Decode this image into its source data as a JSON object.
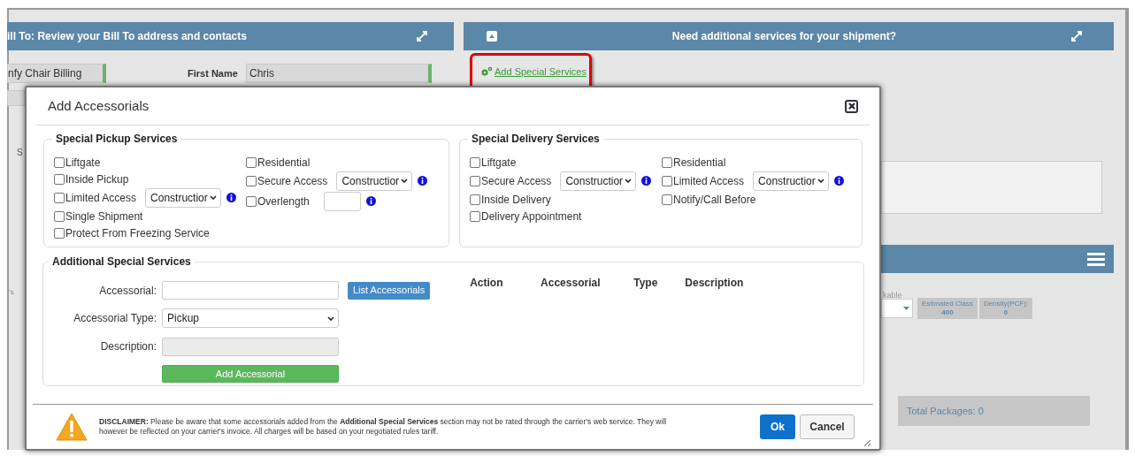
{
  "background": {
    "left_panel": {
      "title": "ill To: Review your Bill To address and contacts",
      "company_value": "nfy Chair Billing",
      "first_name_label": "First Name",
      "first_name_value": "Chris",
      "stray_label": "S",
      "stray_text": "’s"
    },
    "right_panel": {
      "title": "Need additional services for your shipment?",
      "link": "Add Special Services"
    },
    "lower_panel": {
      "label": "kable",
      "estimated_class_label": "Estimated Class",
      "estimated_class_value": "400",
      "density_label": "Density(PCF):",
      "density_value": "0",
      "total_packages": "Total Packages: 0"
    }
  },
  "modal": {
    "title": "Add Accessorials",
    "sections": [
      {
        "title": "Special Pickup Services",
        "columns": [
          [
            {
              "kind": "checkbox",
              "label": "Liftgate",
              "checked": false
            },
            {
              "kind": "checkbox",
              "label": "Inside Pickup",
              "checked": false
            },
            {
              "kind": "select",
              "label": "Limited Access",
              "checked": false,
              "value": "Constructior"
            },
            {
              "kind": "checkbox",
              "label": "Single Shipment",
              "checked": false
            },
            {
              "kind": "checkbox",
              "label": "Protect From Freezing Service",
              "checked": false
            }
          ],
          [
            {
              "kind": "checkbox",
              "label": "Residential",
              "checked": false
            },
            {
              "kind": "select",
              "label": "Secure Access",
              "checked": false,
              "value": "Constructior"
            },
            {
              "kind": "input",
              "label": "Overlength",
              "checked": false
            }
          ]
        ]
      },
      {
        "title": "Special Delivery Services",
        "columns": [
          [
            {
              "kind": "checkbox",
              "label": "Liftgate",
              "checked": false
            },
            {
              "kind": "select",
              "label": "Secure Access",
              "checked": false,
              "value": "Constructior"
            },
            {
              "kind": "checkbox",
              "label": "Inside Delivery",
              "checked": false
            },
            {
              "kind": "checkbox",
              "label": "Delivery Appointment",
              "checked": false
            }
          ],
          [
            {
              "kind": "checkbox",
              "label": "Residential",
              "checked": false
            },
            {
              "kind": "select",
              "label": "Limited Access",
              "checked": false,
              "value": "Constructior"
            },
            {
              "kind": "checkbox",
              "label": "Notify/Call Before",
              "checked": false
            }
          ]
        ]
      }
    ],
    "additional": {
      "title": "Additional Special Services",
      "accessorial_label": "Accessorial:",
      "type_label": "Accessorial Type:",
      "type_value": "Pickup",
      "description_label": "Description:",
      "list_button": "List Accessorials",
      "add_button": "Add Accessorial",
      "columns": [
        "Action",
        "Accessorial",
        "Type",
        "Description"
      ]
    },
    "disclaimer": "**DISCLAIMER:** Please be aware that some accessorials added from the **Additional Special Services** section may not be rated through the carrier's web service. They will however be reflected on your carrier's invoice. All charges will be based on your negotiated rules tariff.",
    "buttons": {
      "ok": "Ok",
      "cancel": "Cancel"
    }
  }
}
